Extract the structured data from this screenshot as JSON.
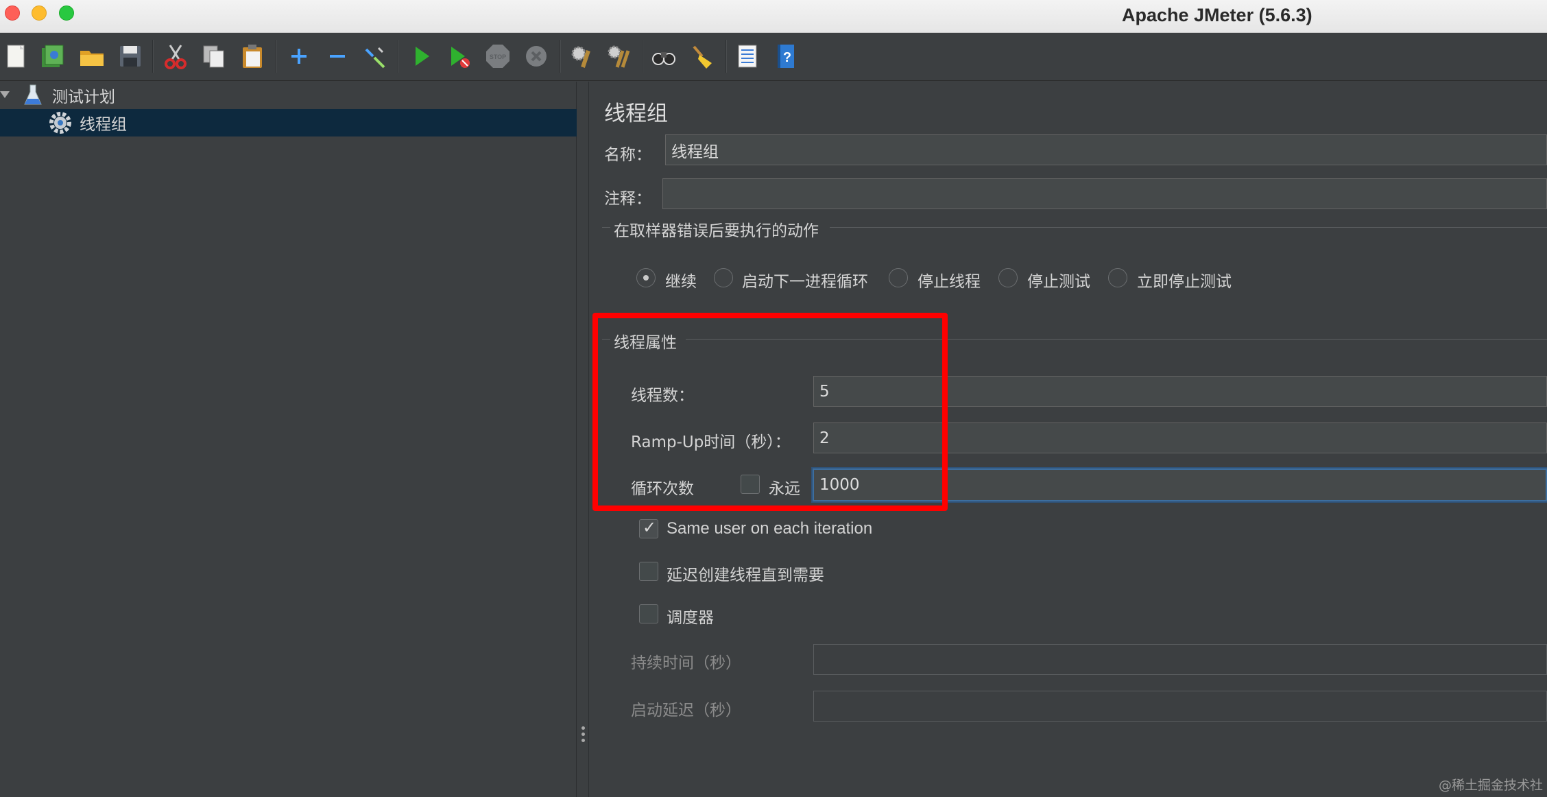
{
  "window": {
    "title": "Apache JMeter (5.6.3)"
  },
  "toolbar": {
    "buttons": [
      {
        "name": "new",
        "icon": "new-document-icon"
      },
      {
        "name": "templates",
        "icon": "templates-icon"
      },
      {
        "name": "open",
        "icon": "open-folder-icon"
      },
      {
        "name": "save",
        "icon": "save-icon"
      },
      {
        "name": "cut",
        "icon": "scissors-icon"
      },
      {
        "name": "copy",
        "icon": "copy-icon"
      },
      {
        "name": "paste",
        "icon": "paste-icon"
      },
      {
        "name": "expand",
        "icon": "plus-icon"
      },
      {
        "name": "collapse",
        "icon": "minus-icon"
      },
      {
        "name": "toggle",
        "icon": "toggle-wand-icon"
      },
      {
        "name": "start",
        "icon": "play-icon"
      },
      {
        "name": "start-no-pauses",
        "icon": "play-no-timers-icon"
      },
      {
        "name": "stop",
        "icon": "stop-icon"
      },
      {
        "name": "shutdown",
        "icon": "shutdown-icon"
      },
      {
        "name": "clear",
        "icon": "clear-broom-gear-icon"
      },
      {
        "name": "clear-all",
        "icon": "clear-all-icon"
      },
      {
        "name": "search",
        "icon": "binoculars-icon"
      },
      {
        "name": "reset-search",
        "icon": "broom-icon"
      },
      {
        "name": "function-helper",
        "icon": "list-icon"
      },
      {
        "name": "help",
        "icon": "help-book-icon"
      }
    ]
  },
  "tree": {
    "root": {
      "label": "测试计划",
      "icon": "flask-icon",
      "expanded": true
    },
    "child": {
      "label": "线程组",
      "icon": "gear-icon",
      "selected": true
    }
  },
  "thread_group": {
    "heading": "线程组",
    "name_label": "名称：",
    "name_value": "线程组",
    "comment_label": "注释：",
    "comment_value": "",
    "error_action": {
      "legend": "在取样器错误后要执行的动作",
      "options": [
        {
          "label": "继续",
          "selected": true
        },
        {
          "label": "启动下一进程循环",
          "selected": false
        },
        {
          "label": "停止线程",
          "selected": false
        },
        {
          "label": "停止测试",
          "selected": false
        },
        {
          "label": "立即停止测试",
          "selected": false
        }
      ]
    },
    "properties": {
      "legend": "线程属性",
      "threads_label": "线程数：",
      "threads_value": "5",
      "rampup_label": "Ramp-Up时间（秒）：",
      "rampup_value": "2",
      "loop_label": "循环次数",
      "forever_label": "永远",
      "forever_checked": false,
      "loop_value": "1000"
    },
    "same_user": {
      "label": "Same user on each iteration",
      "checked": true
    },
    "delay_create": {
      "label": "延迟创建线程直到需要",
      "checked": false
    },
    "scheduler": {
      "label": "调度器",
      "checked": false
    },
    "duration_label": "持续时间（秒）",
    "duration_value": "",
    "startup_delay_label": "启动延迟（秒）",
    "startup_delay_value": ""
  },
  "watermark": "@稀土掘金技术社区",
  "colors": {
    "background": "#3c3f41",
    "selection": "#0d293e",
    "highlight_box": "#ff0000",
    "focus_border": "#3d6e9e"
  }
}
